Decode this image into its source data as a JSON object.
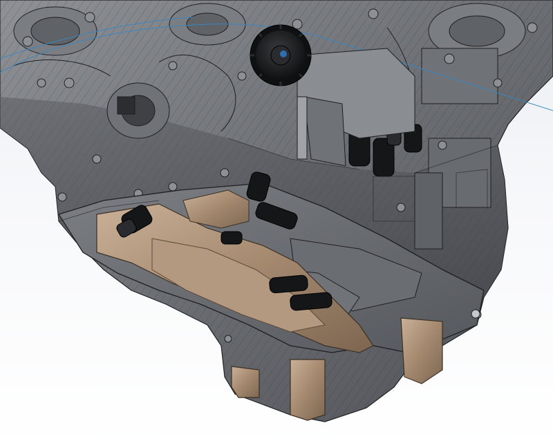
{
  "scene": {
    "type": "cad-render",
    "subject": "engine-block-with-oil-pan",
    "colors": {
      "background_top": "#e9edf2",
      "background_bottom": "#ffffff",
      "casting_dark": "#4a4c50",
      "casting_mid": "#6b6e73",
      "casting_light": "#9a9da2",
      "edge_lines": "#1e1f22",
      "bronze": "#a4896f",
      "bronze_light": "#c7ad92",
      "bronze_dark": "#6e5a47",
      "rubber_black": "#151617",
      "guide_line": "#3a87c0"
    },
    "icons": [
      "gear-icon"
    ]
  }
}
